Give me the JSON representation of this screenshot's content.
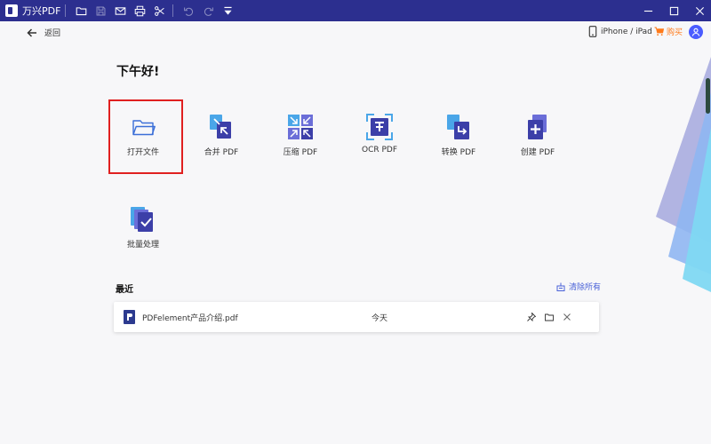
{
  "titlebar": {
    "app_title": "万兴PDF"
  },
  "header": {
    "back_label": "返回",
    "device_label": "iPhone / iPad",
    "buy_label": "购买"
  },
  "greeting": "下午好!",
  "tools": [
    {
      "label": "打开文件"
    },
    {
      "label": "合并 PDF"
    },
    {
      "label": "压缩 PDF"
    },
    {
      "label": "OCR PDF"
    },
    {
      "label": "转换 PDF"
    },
    {
      "label": "创建 PDF"
    },
    {
      "label": "批量处理"
    }
  ],
  "recent": {
    "title": "最近",
    "clear_label": "清除所有",
    "files": [
      {
        "name": "PDFelement产品介绍.pdf",
        "date": "今天"
      }
    ]
  },
  "colors": {
    "titlebar": "#2c2f8f",
    "accent": "#4a62d8",
    "buy": "#ff7a1a",
    "highlight_border": "#e02020"
  }
}
